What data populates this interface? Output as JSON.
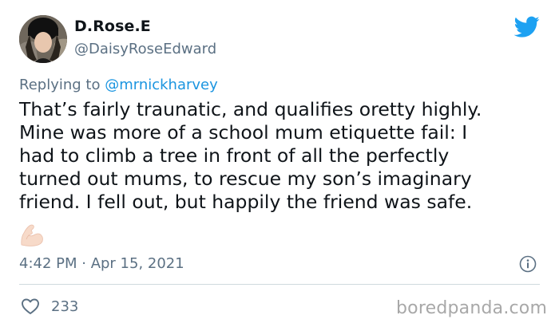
{
  "tweet": {
    "author": {
      "display_name": "D.Rose.E",
      "handle": "@DaisyRoseEdward"
    },
    "reply": {
      "prefix": "Replying to ",
      "mention": "@mrnickharvey"
    },
    "text_lines": [
      "That’s fairly traunatic, and qualifies oretty highly.",
      "Mine was more of a school mum etiquette fail: I",
      "had to climb a tree in front of all the perfectly",
      "turned out mums, to rescue my son’s imaginary",
      "friend. I fell out, but happily the friend was safe."
    ],
    "emoji": "flexed-biceps-light-skin-tone",
    "timestamp": "4:42 PM · Apr 15, 2021",
    "likes": "233"
  },
  "watermark": "boredpanda.com",
  "colors": {
    "text": "#0f1419",
    "secondary": "#5b7083",
    "link": "#1b95e0",
    "twitter_blue": "#1da1f2",
    "divider": "#cfd9de"
  }
}
